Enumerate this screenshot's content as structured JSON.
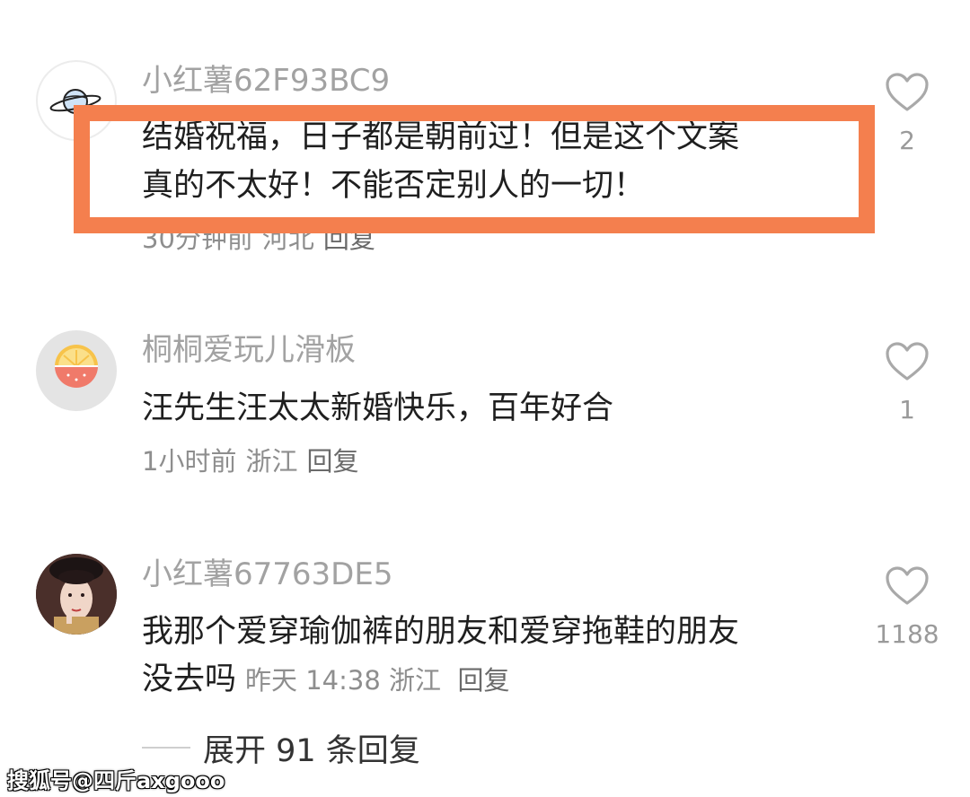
{
  "comments": [
    {
      "username": "小红薯62F93BC9",
      "avatar": "planet-icon",
      "lines": [
        "结婚祝福，日子都是朝前过！但是这个文案",
        "真的不太好！不能否定别人的一切！"
      ],
      "time": "30分钟前",
      "location": "河北",
      "reply": "回复",
      "likes": "2"
    },
    {
      "username": "桐桐爱玩儿滑板",
      "avatar": "orange-slice-icon",
      "lines": [
        "汪先生汪太太新婚快乐，百年好合"
      ],
      "time": "1小时前",
      "location": "浙江",
      "reply": "回复",
      "likes": "1"
    },
    {
      "username": "小红薯67763DE5",
      "avatar": "portrait-photo",
      "lines": [
        "我那个爱穿瑜伽裤的朋友和爱穿拖鞋的朋友",
        "没去吗"
      ],
      "time": "昨天 14:38",
      "location": "浙江",
      "reply": "回复",
      "likes": "1188"
    }
  ],
  "expand_replies": "展开 91 条回复",
  "watermark": "搜狐号@四斤axgooo",
  "colors": {
    "highlight_border": "#f47f4e",
    "username": "#a2a2a2",
    "text": "#1f1f1f",
    "meta": "#8e8e8e"
  },
  "icons": {
    "like": "heart-outline-icon"
  }
}
